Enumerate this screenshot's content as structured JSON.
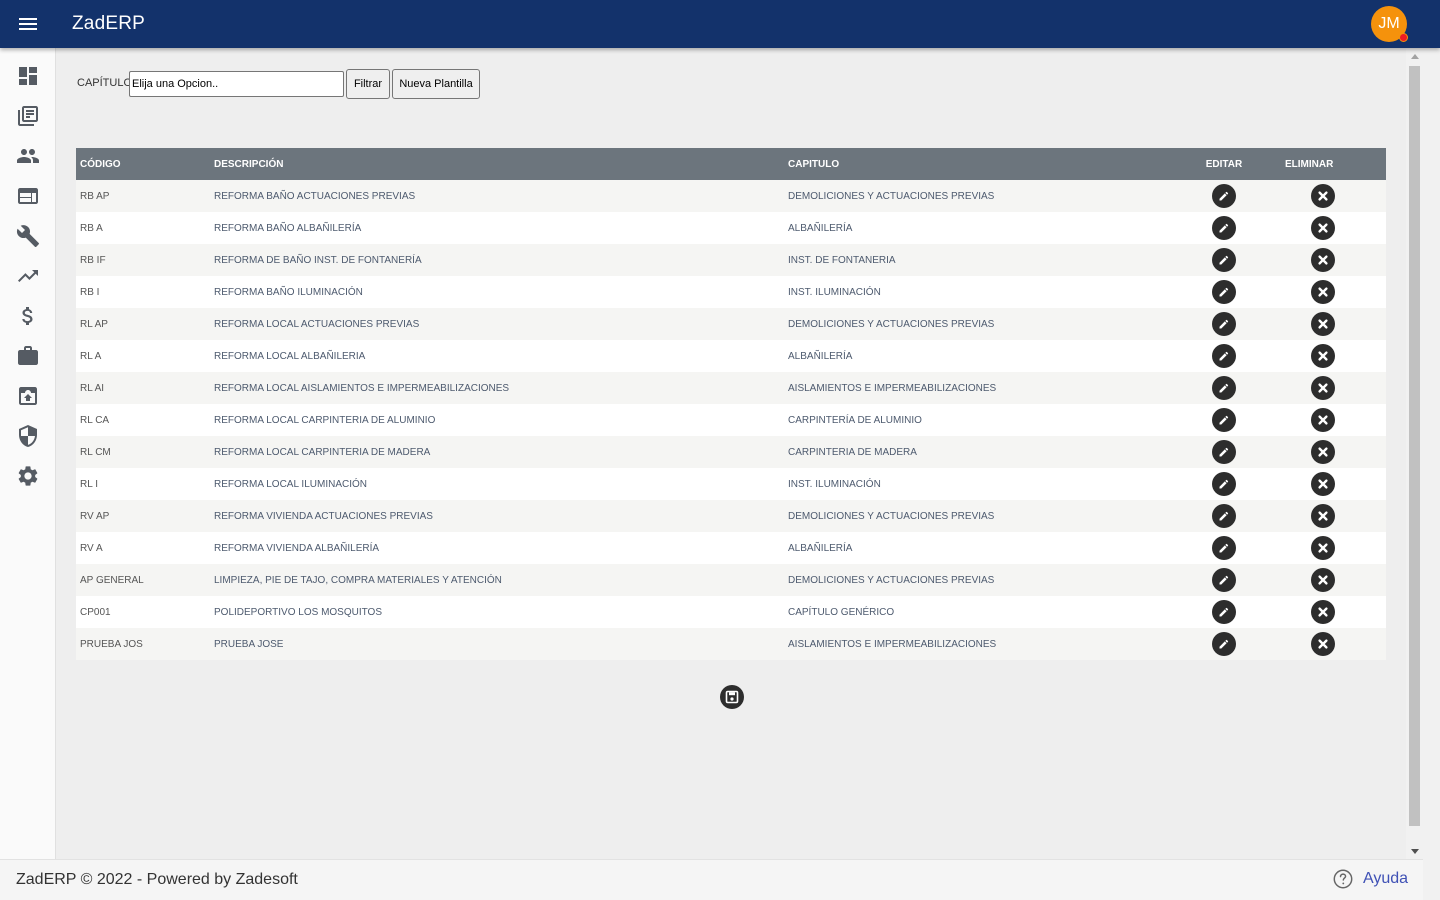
{
  "app": {
    "title": "ZadERP"
  },
  "user": {
    "initials": "JM"
  },
  "sidebar": {
    "items": [
      {
        "icon": "dashboard-icon"
      },
      {
        "icon": "library-icon"
      },
      {
        "icon": "people-icon"
      },
      {
        "icon": "web-window-icon"
      },
      {
        "icon": "wrench-icon"
      },
      {
        "icon": "trending-up-icon"
      },
      {
        "icon": "dollar-icon"
      },
      {
        "icon": "briefcase-icon"
      },
      {
        "icon": "archive-icon"
      },
      {
        "icon": "shield-icon"
      },
      {
        "icon": "gear-icon"
      }
    ]
  },
  "filter": {
    "label": "CAPÍTULO",
    "value": "Elija una Opcion..",
    "filter_button": "Filtrar",
    "new_button": "Nueva Plantilla"
  },
  "table": {
    "headers": [
      "CÓDIGO",
      "DESCRIPCIÓN",
      "CAPITULO",
      "EDITAR",
      "ELIMINAR"
    ],
    "rows": [
      {
        "codigo": "RB AP",
        "descripcion": "REFORMA BAÑO ACTUACIONES PREVIAS",
        "capitulo": "DEMOLICIONES Y ACTUACIONES PREVIAS"
      },
      {
        "codigo": "RB A",
        "descripcion": "REFORMA BAÑO ALBAÑILERÍA",
        "capitulo": "ALBAÑILERÍA"
      },
      {
        "codigo": "RB IF",
        "descripcion": "REFORMA DE BAÑO INST. DE FONTANERÍA",
        "capitulo": "INST. DE FONTANERIA"
      },
      {
        "codigo": "RB I",
        "descripcion": "REFORMA BAÑO ILUMINACIÓN",
        "capitulo": "INST. ILUMINACIÓN"
      },
      {
        "codigo": "RL AP",
        "descripcion": "REFORMA LOCAL ACTUACIONES PREVIAS",
        "capitulo": "DEMOLICIONES Y ACTUACIONES PREVIAS"
      },
      {
        "codigo": "RL A",
        "descripcion": "REFORMA LOCAL ALBAÑILERIA",
        "capitulo": "ALBAÑILERÍA"
      },
      {
        "codigo": "RL AI",
        "descripcion": "REFORMA LOCAL AISLAMIENTOS E IMPERMEABILIZACIONES",
        "capitulo": "AISLAMIENTOS E IMPERMEABILIZACIONES"
      },
      {
        "codigo": "RL CA",
        "descripcion": "REFORMA LOCAL CARPINTERIA DE ALUMINIO",
        "capitulo": "CARPINTERÍA DE ALUMINIO"
      },
      {
        "codigo": "RL CM",
        "descripcion": "REFORMA LOCAL CARPINTERIA DE MADERA",
        "capitulo": "CARPINTERIA DE MADERA"
      },
      {
        "codigo": "RL I",
        "descripcion": "REFORMA LOCAL ILUMINACIÓN",
        "capitulo": "INST. ILUMINACIÓN"
      },
      {
        "codigo": "RV AP",
        "descripcion": "REFORMA VIVIENDA ACTUACIONES PREVIAS",
        "capitulo": "DEMOLICIONES Y ACTUACIONES PREVIAS"
      },
      {
        "codigo": "RV A",
        "descripcion": "REFORMA VIVIENDA ALBAÑILERÍA",
        "capitulo": "ALBAÑILERÍA"
      },
      {
        "codigo": "AP GENERAL",
        "descripcion": "LIMPIEZA, PIE DE TAJO, COMPRA MATERIALES Y ATENCIÓN",
        "capitulo": "DEMOLICIONES Y ACTUACIONES PREVIAS"
      },
      {
        "codigo": "CP001",
        "descripcion": "POLIDEPORTIVO LOS MOSQUITOS",
        "capitulo": "CAPÍTULO GENÉRICO"
      },
      {
        "codigo": "PRUEBA JOS",
        "descripcion": "PRUEBA JOSE",
        "capitulo": "AISLAMIENTOS E IMPERMEABILIZACIONES"
      }
    ]
  },
  "footer": {
    "text": "ZadERP © 2022 - Powered by Zadesoft",
    "help_label": "Ayuda"
  },
  "colors": {
    "topbar": "#13326b",
    "table_header": "#6c757d",
    "avatar": "#f5920c",
    "help_link": "#3f51b5"
  }
}
